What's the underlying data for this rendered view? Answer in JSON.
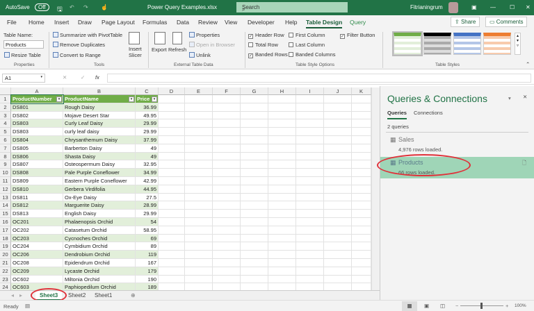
{
  "titlebar": {
    "autosave": "AutoSave",
    "toggle": "Off",
    "filename": "Power Query Examples.xlsx",
    "search_placeholder": "Search",
    "user": "Fitrianingrum"
  },
  "tabs": [
    "File",
    "Home",
    "Insert",
    "Draw",
    "Page Layout",
    "Formulas",
    "Data",
    "Review",
    "View",
    "Developer",
    "Help",
    "Table Design",
    "Query"
  ],
  "share": "Share",
  "comments": "Comments",
  "ribbon": {
    "table_name_label": "Table Name:",
    "table_name": "Products",
    "resize": "Resize Table",
    "properties_group": "Properties",
    "summarize": "Summarize with PivotTable",
    "remove_dup": "Remove Duplicates",
    "convert": "Convert to Range",
    "insert": "Insert",
    "slicer": "Slicer",
    "tools_group": "Tools",
    "export": "Export",
    "refresh": "Refresh",
    "properties": "Properties",
    "open_browser": "Open in Browser",
    "unlink": "Unlink",
    "ext_group": "External Table Data",
    "header_row": "Header Row",
    "total_row": "Total Row",
    "banded_rows": "Banded Rows",
    "first_col": "First Column",
    "last_col": "Last Column",
    "banded_cols": "Banded Columns",
    "filter_btn": "Filter Button",
    "options_group": "Table Style Options",
    "styles_group": "Table Styles"
  },
  "formula": {
    "cell": "A1",
    "fx": "fx"
  },
  "columns": [
    "A",
    "B",
    "C",
    "D",
    "E",
    "F",
    "G",
    "H",
    "I",
    "J",
    "K"
  ],
  "headers": [
    "ProductNumber",
    "ProductName",
    "Price"
  ],
  "rows": [
    [
      "DS801",
      "Rough Daisy",
      "36.99"
    ],
    [
      "DS802",
      "Mojave Desert Star",
      "49.95"
    ],
    [
      "DS803",
      "Curly Leaf Daisy",
      "29.99"
    ],
    [
      "DS803",
      "curly leaf daisy",
      "29.99"
    ],
    [
      "DS804",
      "Chrysanthemum Daisy",
      "37.99"
    ],
    [
      "DS805",
      "Barberton Daisy",
      "49"
    ],
    [
      "DS806",
      "Shasta Daisy",
      "49"
    ],
    [
      "DS807",
      "Osteospermum Daisy",
      "32.95"
    ],
    [
      "DS808",
      "Pale Purple Coneflower",
      "34.99"
    ],
    [
      "DS809",
      "Eastern Purple Coneflower",
      "42.99"
    ],
    [
      "DS810",
      "Gerbera Virdifolia",
      "44.95"
    ],
    [
      "DS811",
      "Ox-Eye Daisy",
      "27.5"
    ],
    [
      "DS812",
      "Marguerite Daisy",
      "28.99"
    ],
    [
      "DS813",
      "English Daisy",
      "29.99"
    ],
    [
      "OC201",
      "Phalaenopsis Orchid",
      "54"
    ],
    [
      "OC202",
      "Catasetum Orchid",
      "58.95"
    ],
    [
      "OC203",
      "Cycnoches Orchid",
      "69"
    ],
    [
      "OC204",
      "Cymbidium Orchid",
      "89"
    ],
    [
      "OC206",
      "Dendrobium Orchid",
      "119"
    ],
    [
      "OC208",
      "Epidendrum Orchid",
      "167"
    ],
    [
      "OC209",
      "Lycaste Orchid",
      "179"
    ],
    [
      "OC602",
      "Miltonia Orchid",
      "190"
    ],
    [
      "OC603",
      "Paphiopedilum Orchid",
      "189"
    ]
  ],
  "sheets": [
    "Sheet3",
    "Sheet2",
    "Sheet1"
  ],
  "pane": {
    "title": "Queries & Connections",
    "tab_queries": "Queries",
    "tab_connections": "Connections",
    "count": "2 queries",
    "queries": [
      {
        "name": "Sales",
        "status": "4,976 rows loaded."
      },
      {
        "name": "Products",
        "status": "66 rows loaded."
      }
    ]
  },
  "status": {
    "ready": "Ready",
    "zoom": "100%"
  }
}
